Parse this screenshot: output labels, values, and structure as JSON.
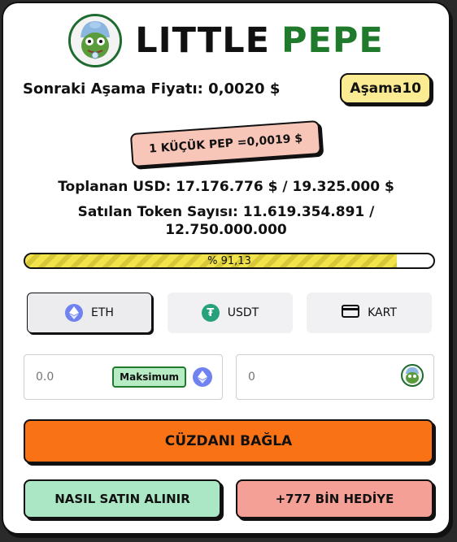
{
  "header": {
    "title_main": "LITTLE",
    "title_accent": "PEPE"
  },
  "stage": {
    "price_label": "Sonraki Aşama Fiyatı: 0,0020 $",
    "stage_badge": "Aşama10"
  },
  "rate": {
    "text": "1 KÜÇÜK PEP =0,0019 $"
  },
  "stats": {
    "raised": "Toplanan USD: 17.176.776 $ / 19.325.000 $",
    "tokens_line1": "Satılan Token Sayısı: 11.619.354.891 /",
    "tokens_line2": "12.750.000.000"
  },
  "progress": {
    "percent_label": "% 91,13",
    "fraction": 0.9113
  },
  "payment": {
    "options": [
      {
        "label": "ETH",
        "icon": "eth-icon",
        "active": true
      },
      {
        "label": "USDT",
        "icon": "tether-icon",
        "active": false
      },
      {
        "label": "KART",
        "icon": "credit-card-icon",
        "active": false
      }
    ]
  },
  "inputs": {
    "pay_placeholder": "0.0",
    "max_label": "Maksimum",
    "receive_placeholder": "0"
  },
  "actions": {
    "connect_wallet": "CÜZDANI BAĞLA",
    "how_to_buy": "NASIL SATIN ALINIR",
    "bonus": "+777 BİN HEDİYE"
  },
  "colors": {
    "green": "#1f7a2c",
    "yellow_badge": "#fbeb93",
    "orange": "#f97316",
    "mint": "#abe7c4",
    "salmon": "#f5a097",
    "eth_blue": "#6f82f0",
    "tether_green": "#26a17b"
  }
}
